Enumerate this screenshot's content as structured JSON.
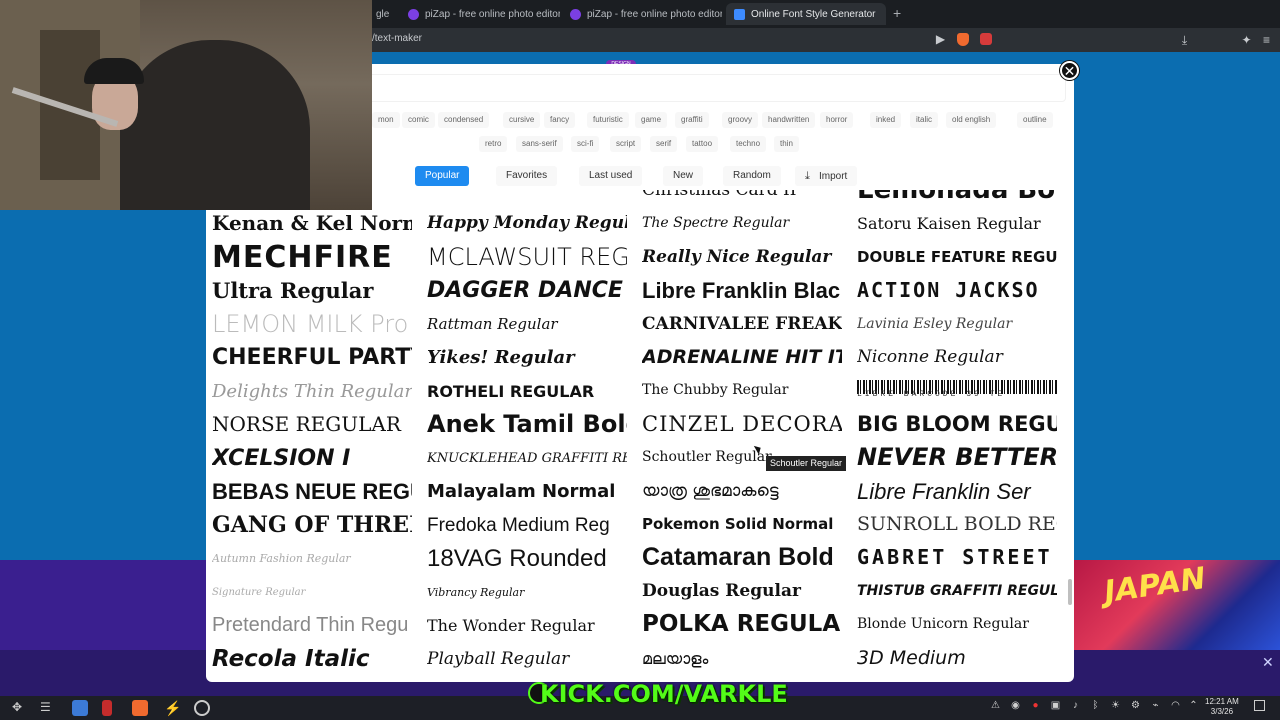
{
  "browser": {
    "tabs": [
      {
        "label": "gle"
      },
      {
        "label": "piZap - free online photo editor"
      },
      {
        "label": "piZap - free online photo editor"
      },
      {
        "label": "Online Font Style Generator"
      }
    ],
    "url": "/text-maker"
  },
  "design_badge": "DESIGN",
  "modal": {
    "tags_row1": [
      "mon",
      "comic",
      "condensed",
      "cursive",
      "fancy",
      "futuristic",
      "game",
      "graffiti",
      "groovy",
      "handwritten",
      "horror",
      "inked",
      "italic",
      "old english",
      "outline"
    ],
    "tags_row2": [
      "retro",
      "sans-serif",
      "sci-fi",
      "script",
      "serif",
      "tattoo",
      "techno",
      "thin"
    ],
    "filters": [
      "Popular",
      "Favorites",
      "Last used",
      "New",
      "Random",
      "Import"
    ],
    "active_filter": "Popular",
    "fonts": [
      [
        "Kenan & Kel Normal",
        "MECHFIRE",
        "Ultra Regular",
        "LEMON MILK Pro",
        "CHEERFUL PARTY",
        "Delights Thin Regular",
        "NORSE REGULAR",
        "XCELSION I",
        "BEBAS NEUE REGULAR",
        "GANG OF THREE R",
        "Autumn Fashion Regular",
        "Signature Regular",
        "Pretendard Thin Regu",
        "Recola Italic"
      ],
      [
        "Happy Monday Regular",
        "MCLAWSUIT REG",
        "DAGGER DANCE",
        "Rattman Regular",
        "Yikes! Regular",
        "ROTHELI REGULAR",
        "Anek Tamil Bold",
        "KNUCKLEHEAD GRAFFITI REGULAR",
        "Malayalam Normal",
        "Fredoka Medium Reg",
        "18VAG Rounded",
        "Vibrancy Regular",
        "The Wonder Regular",
        "Playball Regular"
      ],
      [
        "Christmas Card II",
        "The Spectre Regular",
        "Really Nice Regular",
        "Libre Franklin Blac",
        "CARNIVALEE FREAKSHOW",
        "ADRENALINE HIT ITAL",
        "The Chubby Regular",
        "CINZEL DECORAT",
        "Schoutler Regular",
        "യാത്ര ശുഭമാകട്ടെ",
        "Pokemon Solid Normal",
        "Catamaran Bold",
        "Douglas Regular",
        "POLKA REGULAR",
        "മലയാളം"
      ],
      [
        "Lemonada Bo",
        "Satoru Kaisen Regular",
        "DOUBLE FEATURE REGUL",
        "ACTION JACKSO",
        "Lavinia Esley Regular",
        "Niconne Regular",
        "LIBRE BARCODE 39 TE",
        "BIG BLOOM REGUL",
        "NEVER BETTER",
        "Libre Franklin Ser",
        "SUNROLL BOLD REG",
        "GABRET STREET",
        "THISTUB GRAFFITI REGULAR",
        "Blonde Unicorn Regular",
        "3D Medium"
      ]
    ],
    "tooltip": "Schoutler Regular"
  },
  "stream": {
    "kick_text": "KICK.COM/VARKLE"
  },
  "taskbar": {
    "time": "12:21 AM",
    "date": "3/3/26"
  }
}
